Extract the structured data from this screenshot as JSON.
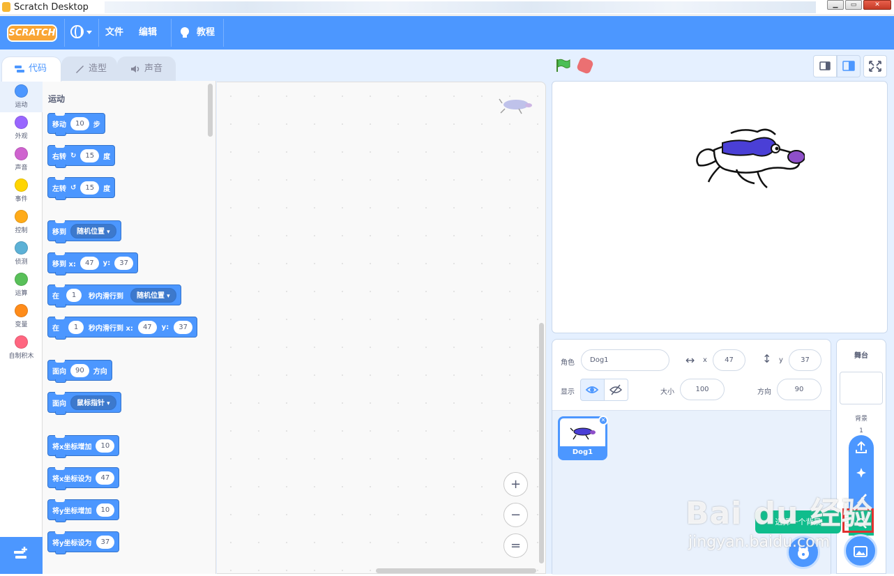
{
  "window": {
    "title": "Scratch Desktop",
    "minimize": "▁",
    "maximize": "▭",
    "close": "✕"
  },
  "menubar": {
    "logo": "SCRATCH",
    "file": "文件",
    "edit": "编辑",
    "tutorials": "教程"
  },
  "tabs": {
    "code": "代码",
    "costumes": "造型",
    "sounds": "声音"
  },
  "categories": [
    {
      "label": "运动",
      "color": "#4c97ff"
    },
    {
      "label": "外观",
      "color": "#9966ff"
    },
    {
      "label": "声音",
      "color": "#cf63cf"
    },
    {
      "label": "事件",
      "color": "#ffd500"
    },
    {
      "label": "控制",
      "color": "#ffab19"
    },
    {
      "label": "侦测",
      "color": "#5cb1d6"
    },
    {
      "label": "运算",
      "color": "#59c059"
    },
    {
      "label": "变量",
      "color": "#ff8c1a"
    },
    {
      "label": "自制积木",
      "color": "#ff6680"
    }
  ],
  "palette": {
    "section": "运动",
    "move": {
      "text": "移动",
      "value": "10",
      "unit": "步"
    },
    "turn_right": {
      "text": "右转",
      "value": "15",
      "unit": "度"
    },
    "turn_left": {
      "text": "左转",
      "value": "15",
      "unit": "度"
    },
    "goto": {
      "text": "移到",
      "option": "随机位置"
    },
    "goto_xy": {
      "text": "移到 x:",
      "x": "47",
      "ylabel": "y:",
      "y": "37"
    },
    "glide": {
      "pre": "在",
      "secs": "1",
      "text": "秒内滑行到",
      "option": "随机位置"
    },
    "glide_xy": {
      "pre": "在",
      "secs": "1",
      "text": "秒内滑行到 x:",
      "x": "47",
      "ylabel": "y:",
      "y": "37"
    },
    "point": {
      "text": "面向",
      "value": "90",
      "unit": "方向"
    },
    "point_towards": {
      "text": "面向",
      "option": "鼠标指针"
    },
    "change_x": {
      "text": "将x坐标增加",
      "value": "10"
    },
    "set_x": {
      "text": "将x坐标设为",
      "value": "47"
    },
    "change_y": {
      "text": "将y坐标增加",
      "value": "10"
    },
    "set_y": {
      "text": "将y坐标设为",
      "value": "37"
    }
  },
  "zoom": {
    "in": "+",
    "out": "−",
    "reset": "="
  },
  "sprite_info": {
    "sprite_label": "角色",
    "sprite_name": "Dog1",
    "x_label": "x",
    "x": "47",
    "y_label": "y",
    "y": "37",
    "show_label": "显示",
    "size_label": "大小",
    "size": "100",
    "direction_label": "方向",
    "direction": "90"
  },
  "sprites": [
    {
      "name": "Dog1"
    }
  ],
  "stage_panel": {
    "title": "舞台",
    "backdrops_label": "背景",
    "backdrops_count": "1"
  },
  "tooltip": "选择一个背景",
  "watermark": {
    "main": "Bai du 经验",
    "sub": "jingyan.baidu.com"
  }
}
